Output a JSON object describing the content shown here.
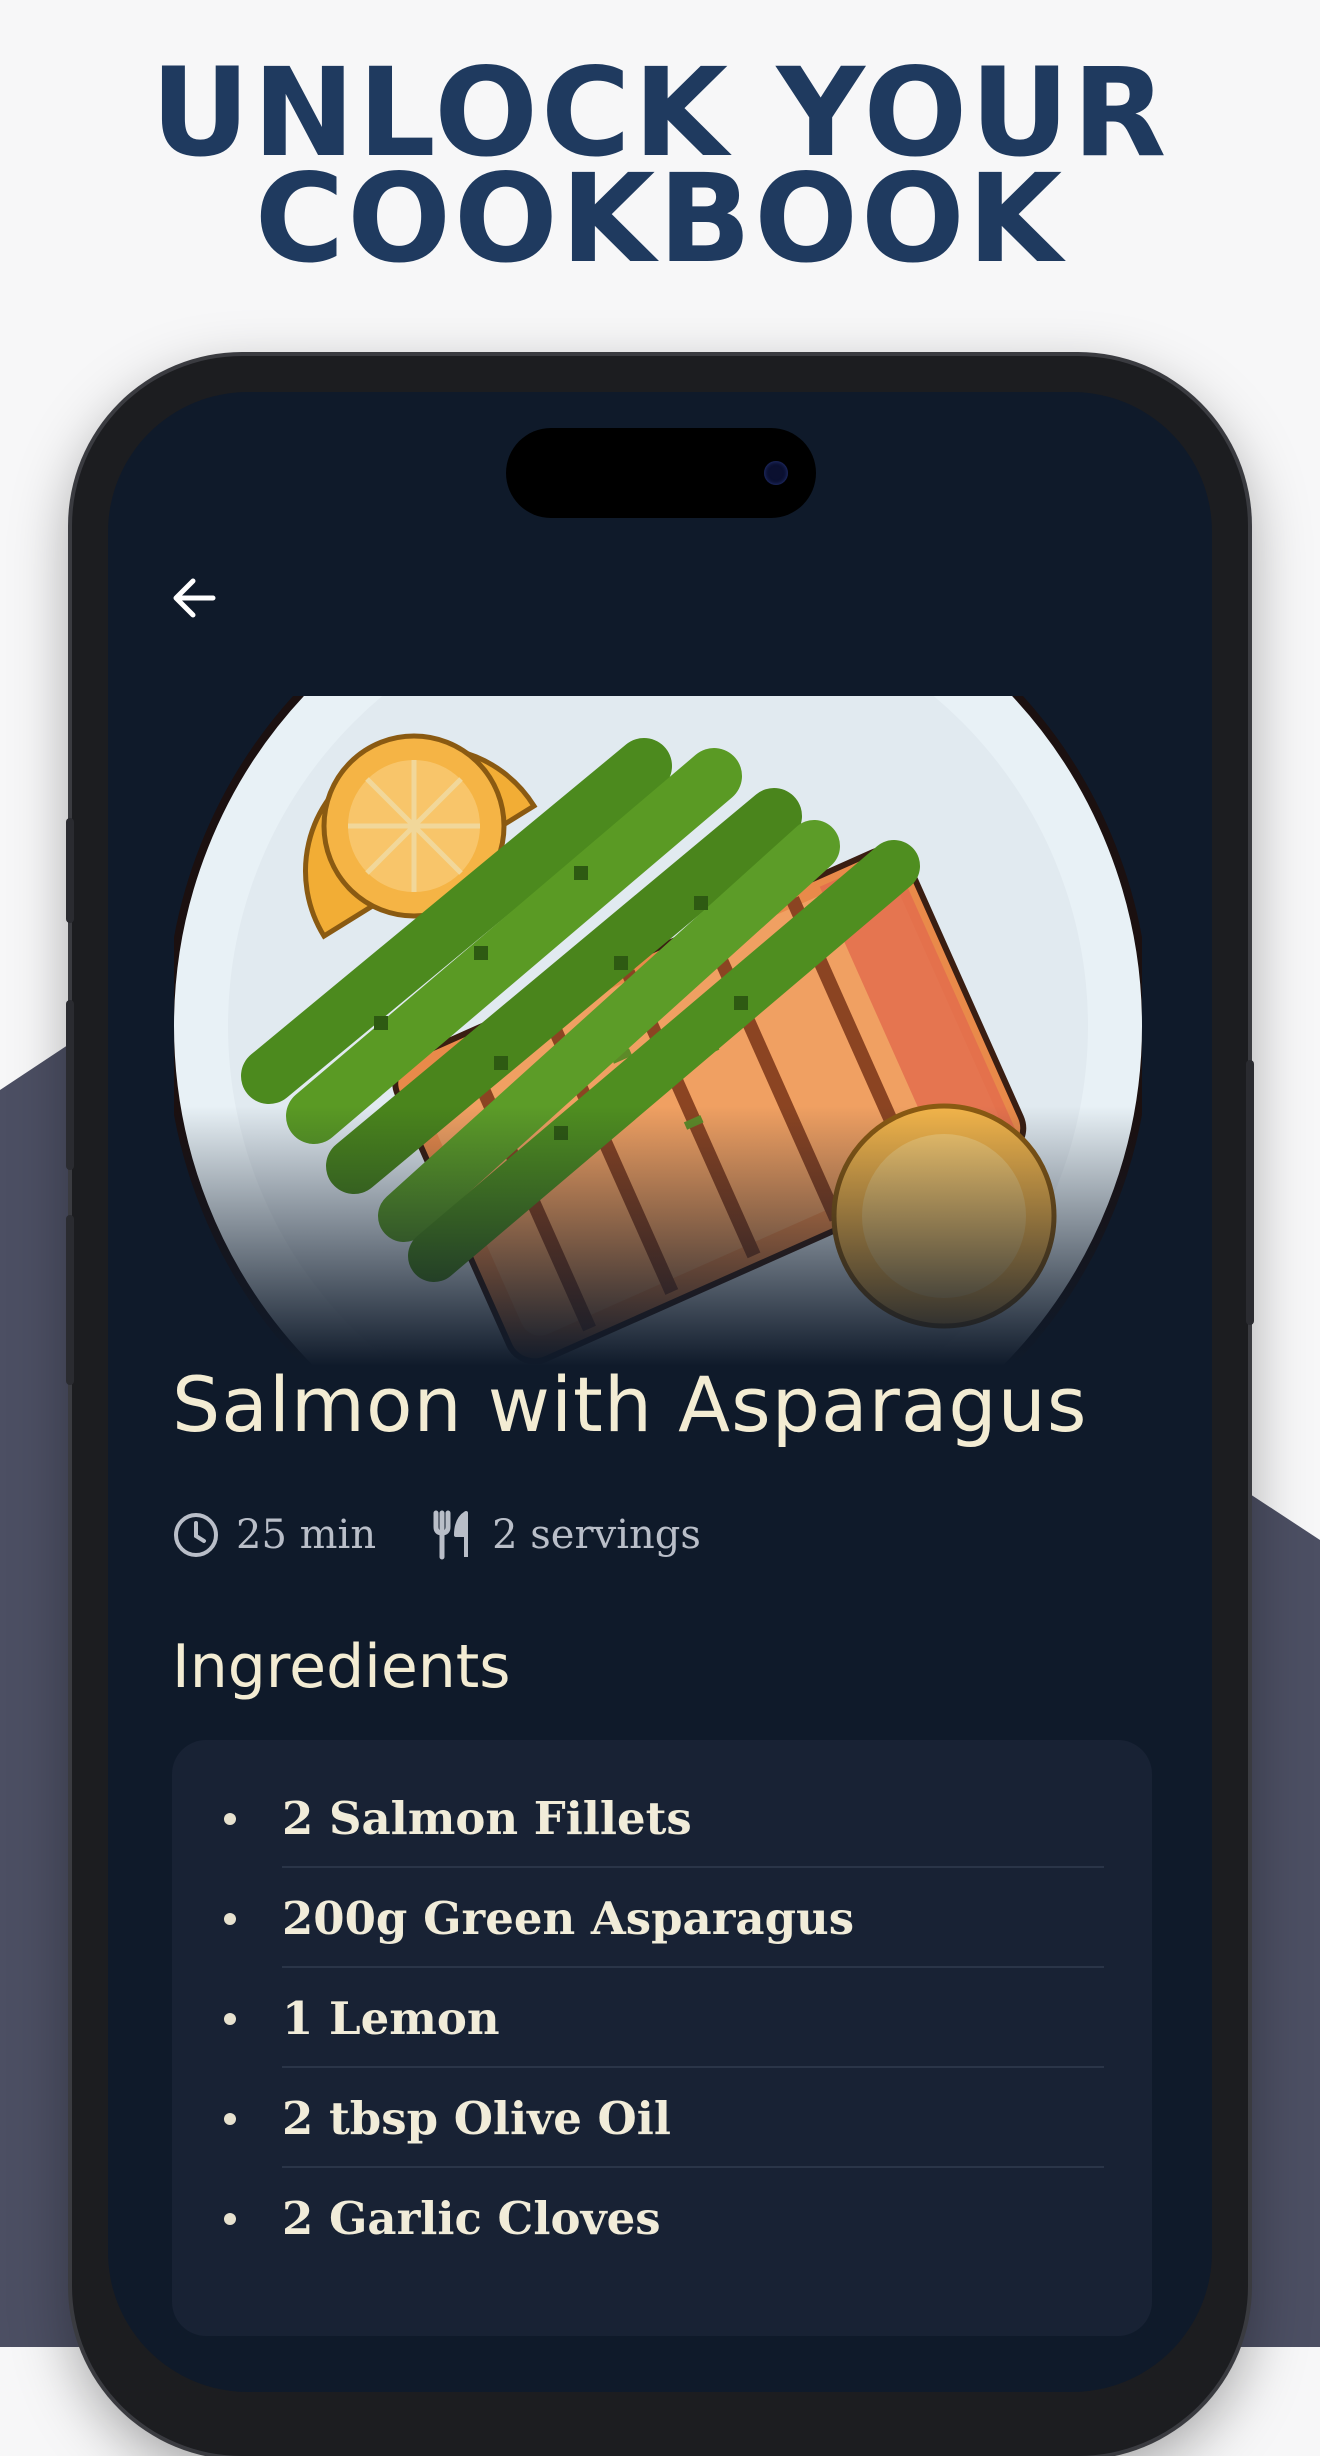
{
  "headline": {
    "line1": "UNLOCK YOUR",
    "line2": "COOKBOOK"
  },
  "recipe": {
    "title": "Salmon with Asparagus",
    "time": "25 min",
    "servings": "2 servings",
    "image_alt": "Salmon with Asparagus"
  },
  "ingredients": {
    "heading": "Ingredients",
    "items": [
      {
        "label": "2 Salmon Fillets"
      },
      {
        "label": "200g Green Asparagus"
      },
      {
        "label": "1 Lemon"
      },
      {
        "label": "2 tbsp Olive Oil"
      },
      {
        "label": "2 Garlic Cloves"
      }
    ]
  },
  "icons": {
    "back": "arrow-left-icon",
    "time": "clock-icon",
    "servings": "fork-knife-icon"
  },
  "colors": {
    "headline": "#1f3a5f",
    "screen_bg": "#0f1a2a",
    "card_bg": "#182234",
    "title_text": "#f3ecd3",
    "meta_text": "#b9bec8"
  }
}
